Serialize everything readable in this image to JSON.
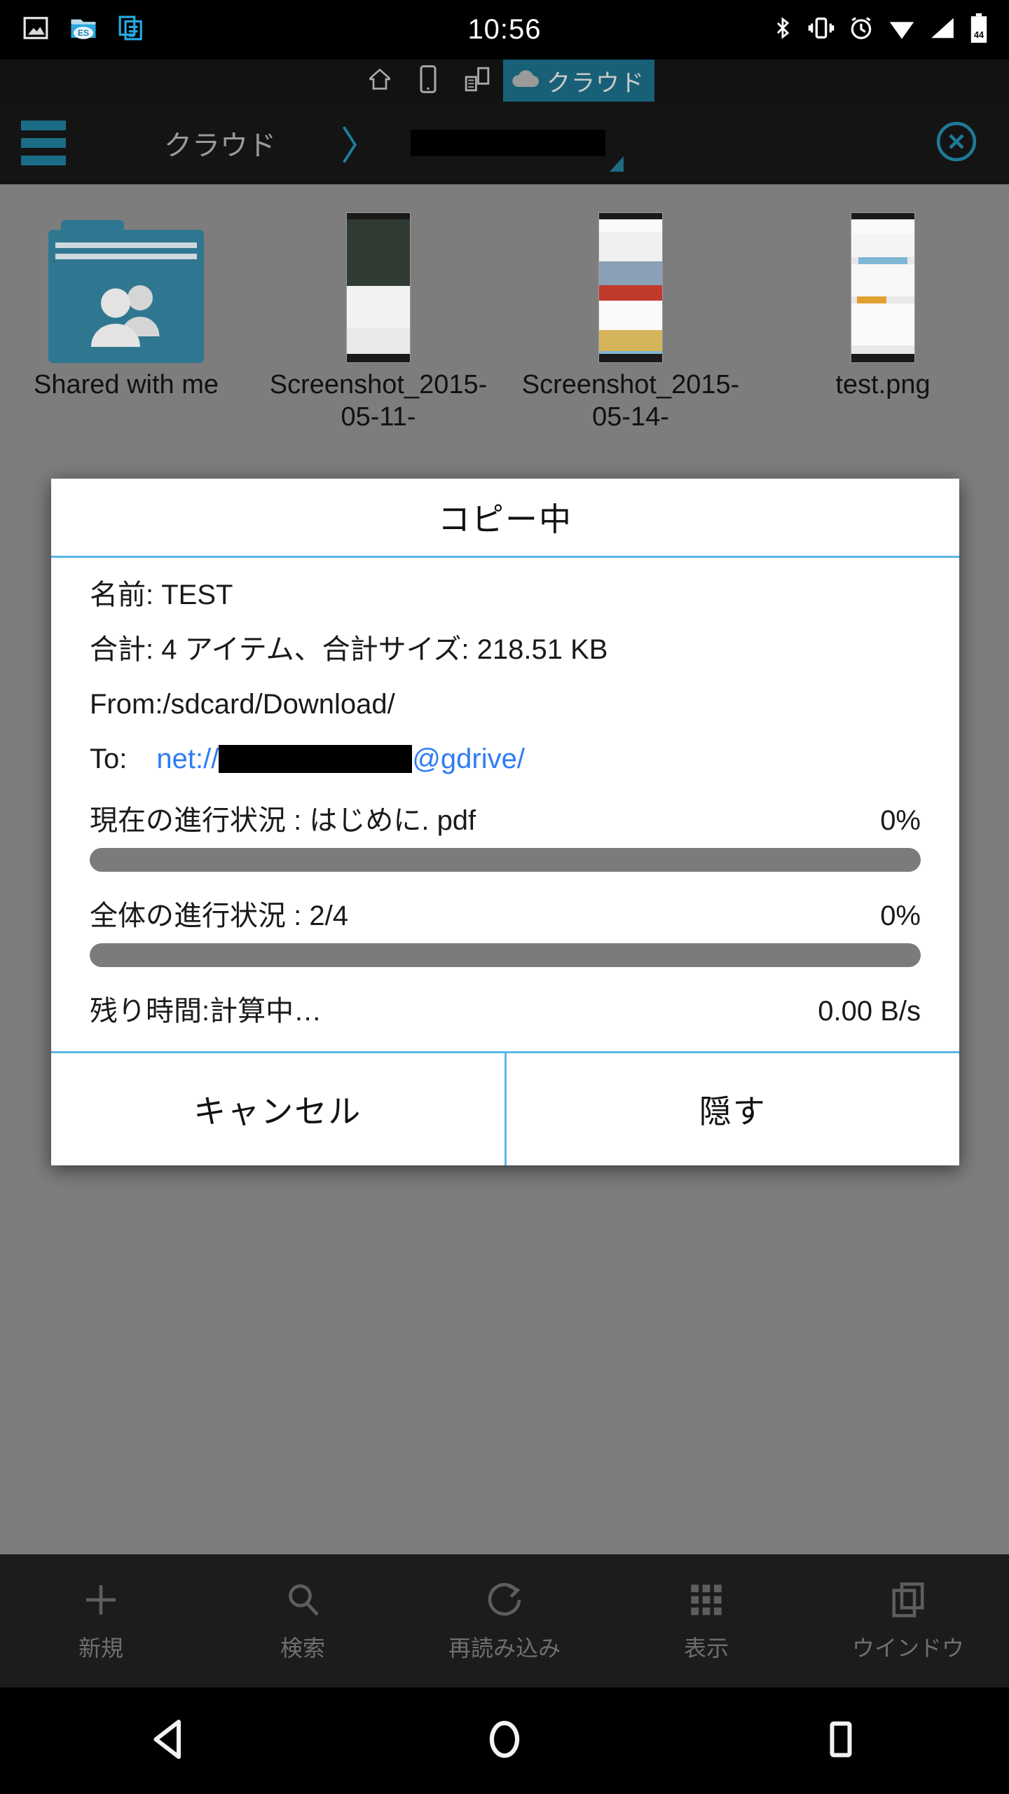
{
  "status_bar": {
    "time": "10:56",
    "battery_level": "44",
    "left_icons": [
      {
        "name": "gallery-image-icon"
      },
      {
        "name": "es-file-explorer-cloud-icon"
      },
      {
        "name": "document-copy-icon"
      }
    ],
    "right_icons": [
      {
        "name": "bluetooth-icon"
      },
      {
        "name": "vibrate-icon"
      },
      {
        "name": "alarm-clock-icon"
      },
      {
        "name": "wifi-icon"
      },
      {
        "name": "cellular-signal-icon"
      },
      {
        "name": "battery-icon"
      }
    ]
  },
  "tabs": [
    {
      "name": "tab-home",
      "icon": "home-icon",
      "label": "",
      "active": false
    },
    {
      "name": "tab-device",
      "icon": "phone-icon",
      "label": "",
      "active": false
    },
    {
      "name": "tab-network",
      "icon": "lan-icon",
      "label": "",
      "active": false
    },
    {
      "name": "tab-cloud",
      "icon": "cloud-icon",
      "label": "クラウド",
      "active": true
    }
  ],
  "path_bar": {
    "menu_icon": "hamburger-menu-icon",
    "crumb": "クラウド",
    "separator": "〉",
    "redacted_segment": "",
    "close_icon": "close-circle-icon"
  },
  "files": [
    {
      "label": "Shared with me",
      "thumb": "shared-folder-icon"
    },
    {
      "label": "Screenshot_2015-05-11-",
      "thumb": "screenshot-thumbnail"
    },
    {
      "label": "Screenshot_2015-05-14-",
      "thumb": "screenshot-thumbnail"
    },
    {
      "label": "test.png",
      "thumb": "screenshot-thumbnail"
    }
  ],
  "dialog": {
    "title": "コピー中",
    "name_row": "名前: TEST",
    "total_row": "合計: 4 アイテム、合計サイズ: 218.51 KB",
    "from_row": "From:/sdcard/Download/",
    "to_label": "To:",
    "to_prefix": "net://",
    "to_suffix": "@gdrive/",
    "current_label": "現在の進行状況 : はじめに. pdf",
    "current_percent": "0%",
    "current_value": 0,
    "overall_label": "全体の進行状況 : 2/4",
    "overall_percent": "0%",
    "overall_value": 0,
    "eta_label": "残り時間:計算中…",
    "speed": "0.00 B/s",
    "cancel_label": "キャンセル",
    "hide_label": "隠す",
    "accent_color": "#5ab8e8",
    "link_color": "#2f7df5"
  },
  "toolbar": [
    {
      "label": "新規",
      "icon": "plus-icon"
    },
    {
      "label": "検索",
      "icon": "search-icon"
    },
    {
      "label": "再読み込み",
      "icon": "refresh-icon"
    },
    {
      "label": "表示",
      "icon": "grid-icon"
    },
    {
      "label": "ウインドウ",
      "icon": "windows-icon"
    }
  ],
  "nav_bar": [
    {
      "name": "back-button",
      "icon": "triangle-back-icon"
    },
    {
      "name": "home-button",
      "icon": "circle-home-icon"
    },
    {
      "name": "recents-button",
      "icon": "square-recents-icon"
    }
  ]
}
